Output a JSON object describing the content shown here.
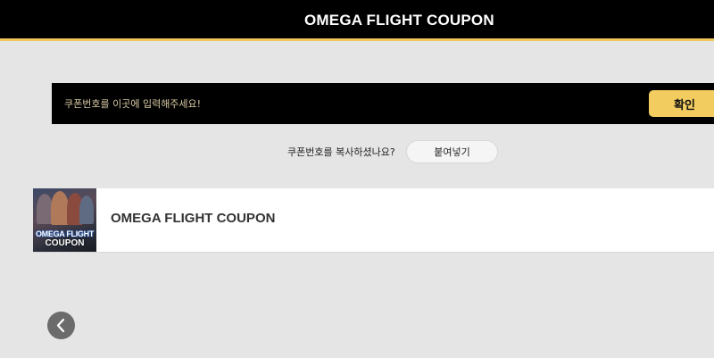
{
  "header": {
    "title": "OMEGA FLIGHT COUPON"
  },
  "coupon_form": {
    "input_placeholder": "쿠폰번호를 이곳에 입력해주세요!",
    "input_value": "",
    "confirm_label": "확인"
  },
  "paste": {
    "prompt": "쿠폰번호를 복사하셨나요?",
    "button_label": "붙여넣기"
  },
  "coupon_card": {
    "thumbnail_line1": "OMEGA FLIGHT",
    "thumbnail_line2": "COUPON",
    "title": "OMEGA FLIGHT COUPON"
  },
  "colors": {
    "accent": "#f2cc5f",
    "header_bg": "#000000",
    "page_bg": "#e5e5e5"
  },
  "icons": {
    "back": "chevron-left-icon"
  }
}
